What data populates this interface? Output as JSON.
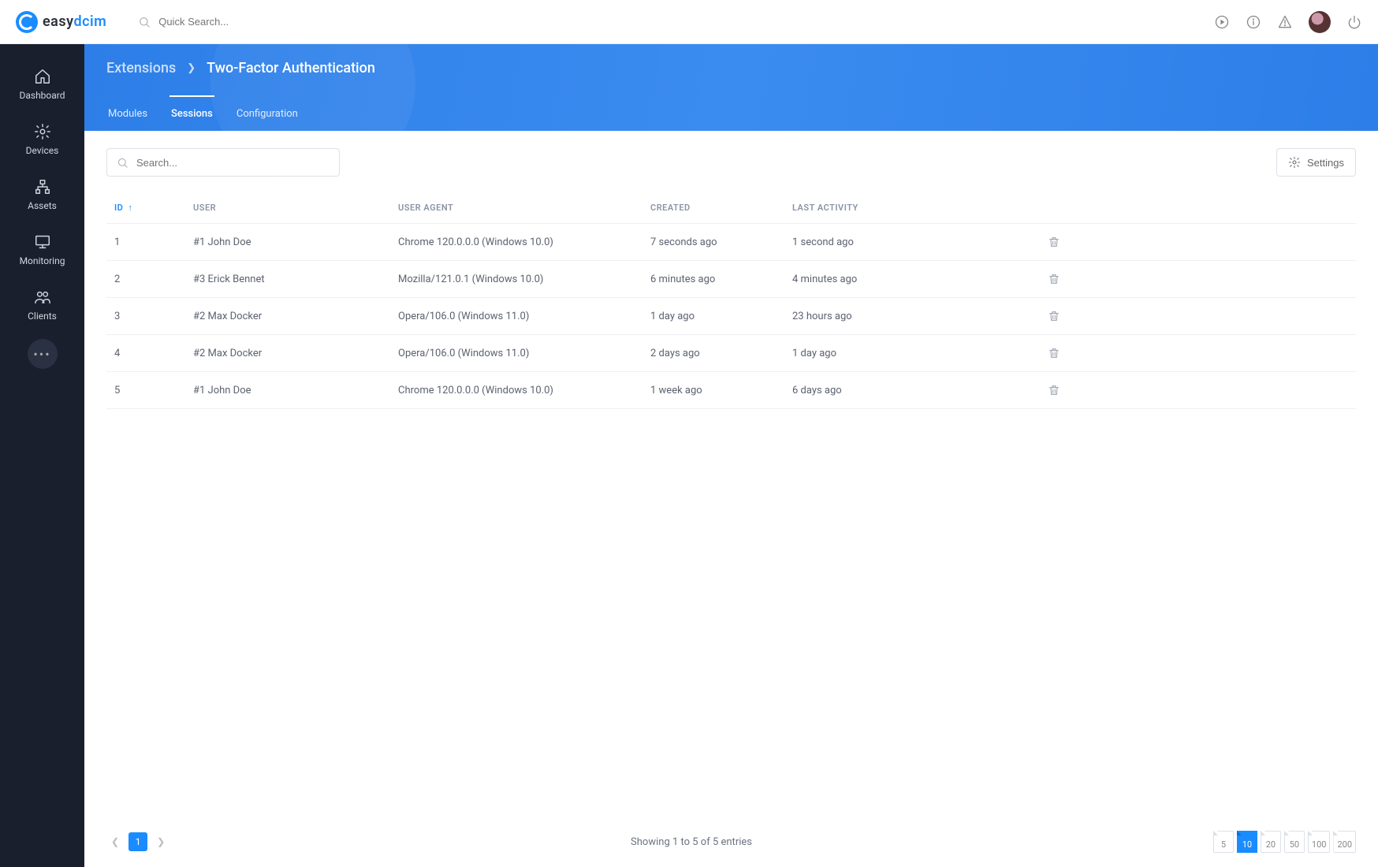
{
  "brand": {
    "name_a": "easy",
    "name_b": "dcim"
  },
  "search_placeholder": "Quick Search...",
  "sidebar": {
    "items": [
      {
        "label": "Dashboard"
      },
      {
        "label": "Devices"
      },
      {
        "label": "Assets"
      },
      {
        "label": "Monitoring"
      },
      {
        "label": "Clients"
      }
    ]
  },
  "breadcrumb": {
    "parent": "Extensions",
    "current": "Two-Factor Authentication"
  },
  "tabs": [
    {
      "label": "Modules",
      "active": false
    },
    {
      "label": "Sessions",
      "active": true
    },
    {
      "label": "Configuration",
      "active": false
    }
  ],
  "toolbar": {
    "search_placeholder": "Search...",
    "settings_label": "Settings"
  },
  "table": {
    "columns": [
      "ID",
      "USER",
      "USER AGENT",
      "CREATED",
      "LAST ACTIVITY"
    ],
    "sort_column": "ID",
    "sort_dir": "asc",
    "rows": [
      {
        "id": "1",
        "user": "#1 John Doe",
        "agent": "Chrome 120.0.0.0 (Windows 10.0)",
        "created": "7 seconds ago",
        "activity": "1 second ago"
      },
      {
        "id": "2",
        "user": "#3 Erick Bennet",
        "agent": "Mozilla/121.0.1 (Windows 10.0)",
        "created": "6 minutes ago",
        "activity": "4 minutes ago"
      },
      {
        "id": "3",
        "user": "#2 Max Docker",
        "agent": "Opera/106.0 (Windows 11.0)",
        "created": "1 day ago",
        "activity": "23 hours ago"
      },
      {
        "id": "4",
        "user": "#2 Max Docker",
        "agent": "Opera/106.0 (Windows 11.0)",
        "created": "2 days ago",
        "activity": "1 day ago"
      },
      {
        "id": "5",
        "user": "#1 John Doe",
        "agent": "Chrome 120.0.0.0 (Windows 10.0)",
        "created": "1 week ago",
        "activity": "6 days ago"
      }
    ]
  },
  "footer": {
    "showing": "Showing 1 to 5 of 5 entries",
    "page": "1",
    "page_sizes": [
      "5",
      "10",
      "20",
      "50",
      "100",
      "200"
    ],
    "active_size": "10"
  }
}
